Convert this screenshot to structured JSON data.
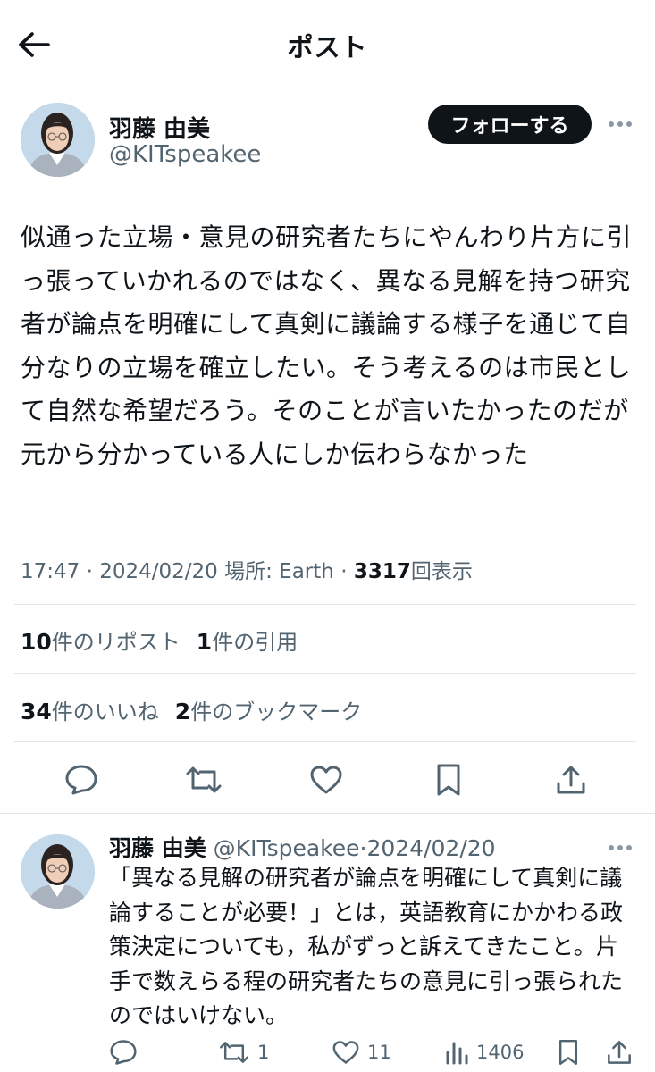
{
  "header": {
    "title": "ポスト",
    "back_icon": "arrow-left-icon"
  },
  "post": {
    "author_name": "羽藤 由美",
    "author_handle": "@KITspeakee",
    "follow_label": "フォローする",
    "body": "似通った立場・意見の研究者たちにやんわり片方に引っ張っていかれるのではなく、異なる見解を持つ研究者が論点を明確にして真剣に議論する様子を通じて自分なりの立場を確立したい。そう考えるのは市民として自然な希望だろう。そのことが言いたかったのだが元から分かっている人にしか伝わらなかった",
    "time": "17:47",
    "sep1": "·",
    "date": "2024/02/20",
    "location": "場所: Earth",
    "sep2": "·",
    "views_count": "3317",
    "views_label": "回表示",
    "reposts_count": "10",
    "reposts_label": "件のリポスト",
    "quotes_count": "1",
    "quotes_label": "件の引用",
    "likes_count": "34",
    "likes_label": "件のいいね",
    "bookmarks_count": "2",
    "bookmarks_label": "件のブックマーク"
  },
  "reply": {
    "author_name": "羽藤 由美",
    "author_handle": "@KITspeakee",
    "sep": "·",
    "date": "2024/02/20",
    "body": "「異なる見解の研究者が論点を明確にして真剣に議論することが必要！」とは，英語教育にかかわる政策決定についても，私がずっと訴えてきたこと。片手で数えらる程の研究者たちの意見に引っ張られたのではいけない。",
    "reply_count": "",
    "repost_count": "1",
    "like_count": "11",
    "views_count": "1406"
  },
  "colors": {
    "text": "#0f1419",
    "secondary": "#536471",
    "divider": "#e1e6ea",
    "follow_bg": "#0f1419"
  }
}
